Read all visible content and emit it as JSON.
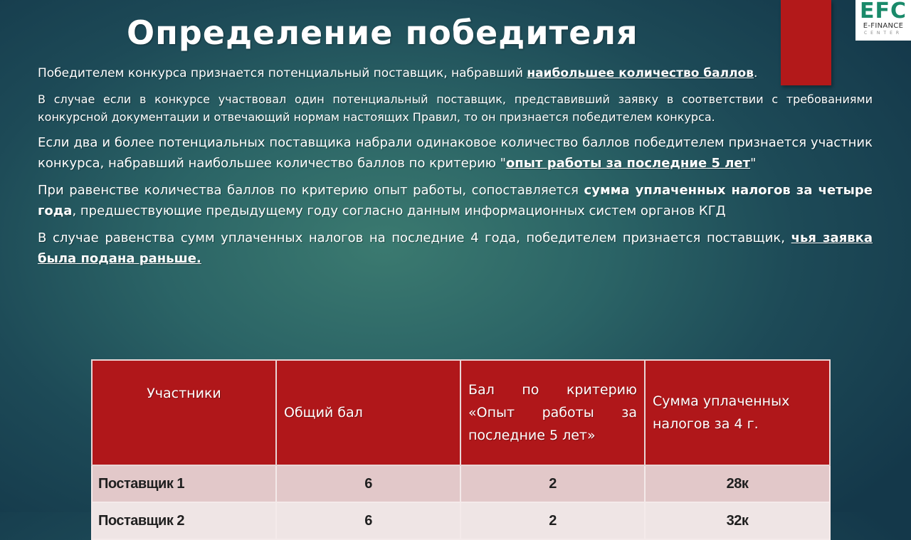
{
  "slide": {
    "title": "Определение победителя",
    "accent_color": "#b3191a",
    "logo": {
      "mark": "EFC",
      "name": "E-FINANCE",
      "sub": "CENTER",
      "color": "#1a8a6a"
    },
    "paragraphs": {
      "p1": {
        "before": "Победителем конкурса признается потенциальный поставщик, набравший ",
        "emphasis": "наибольшее количество баллов",
        "after": "."
      },
      "p2": {
        "text": "В случае если в конкурсе участвовал один потенциальный поставщик, представивший заявку в соответствии с требованиями конкурсной документации и отвечающий нормам настоящих Правил, то он признается победителем конкурса."
      },
      "p3": {
        "before": "Если два и более потенциальных поставщика набрали одинаковое количество баллов победителем признается участник конкурса, набравший наибольшее количество баллов по критерию \"",
        "emphasis": "опыт работы за последние 5 лет",
        "after": "\""
      },
      "p4": {
        "before": "При равенстве количества баллов по критерию опыт работы, сопоставляется ",
        "emphasis": "сумма уплаченных налогов за четыре года",
        "after": ", предшествующие предыдущему году согласно данным информационных систем органов КГД"
      },
      "p5": {
        "before": "В случае равенства сумм уплаченных налогов на последние 4 года, победителем признается поставщик, ",
        "emphasis": "чья заявка была подана раньше."
      }
    },
    "table": {
      "headers": [
        "Участники",
        "Общий бал",
        "Бал по критерию «Опыт работы за последние 5 лет»",
        "Сумма уплаченных налогов за 4 г."
      ],
      "rows": [
        [
          "Поставщик 1",
          "6",
          "2",
          "28к"
        ],
        [
          "Поставщик 2",
          "6",
          "2",
          "32к"
        ]
      ]
    }
  }
}
